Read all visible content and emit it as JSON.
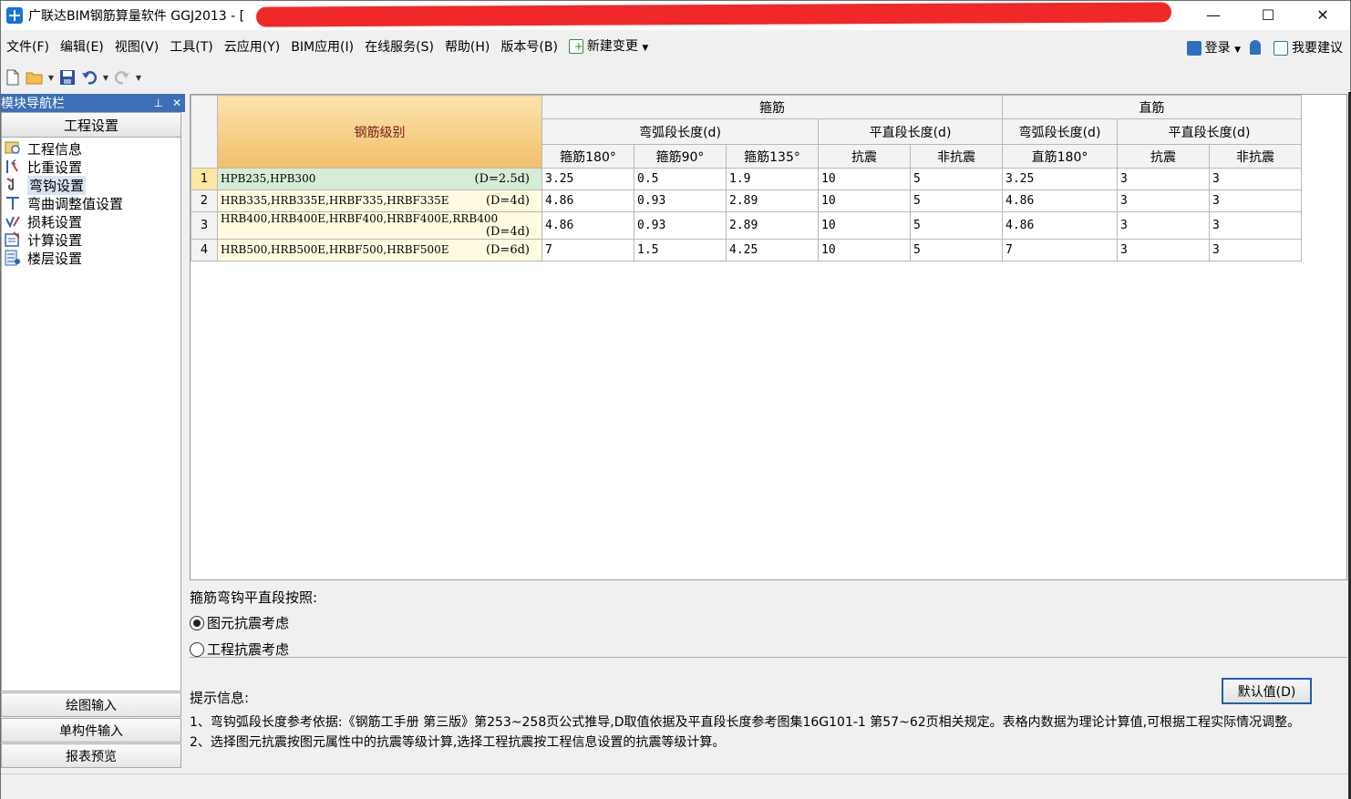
{
  "window": {
    "title": "广联达BIM钢筋算量软件 GGJ2013 - [",
    "min_label": "—",
    "max_label": "☐",
    "close_label": "✕"
  },
  "menu": {
    "items": [
      "文件(F)",
      "编辑(E)",
      "视图(V)",
      "工具(T)",
      "云应用(Y)",
      "BIM应用(I)",
      "在线服务(S)",
      "帮助(H)",
      "版本号(B)",
      "新建变更"
    ],
    "login": "登录",
    "suggest": "我要建议"
  },
  "nav": {
    "panel_title": "模块导航栏",
    "section": "工程设置",
    "items": [
      "工程信息",
      "比重设置",
      "弯钩设置",
      "弯曲调整值设置",
      "损耗设置",
      "计算设置",
      "楼层设置"
    ],
    "selected": "弯钩设置",
    "bottom": [
      "绘图输入",
      "单构件输入",
      "报表预览"
    ]
  },
  "grid": {
    "grade_header": "钢筋级别",
    "group_stirrup": "箍筋",
    "group_straight": "直筋",
    "arc_len": "弯弧段长度(d)",
    "flat_len": "平直段长度(d)",
    "stirrup_arc_cols": [
      "箍筋180°",
      "箍筋90°",
      "箍筋135°"
    ],
    "stirrup_flat_cols": [
      "抗震",
      "非抗震"
    ],
    "straight_arc_cols": [
      "直筋180°"
    ],
    "straight_flat_cols": [
      "抗震",
      "非抗震"
    ],
    "rows": [
      {
        "n": "1",
        "name": "HPB235,HPB300",
        "d": "(D=2.5d)",
        "v": [
          "3.25",
          "0.5",
          "1.9",
          "10",
          "5",
          "3.25",
          "3",
          "3"
        ]
      },
      {
        "n": "2",
        "name": "HRB335,HRB335E,HRBF335,HRBF335E",
        "d": "(D=4d)",
        "v": [
          "4.86",
          "0.93",
          "2.89",
          "10",
          "5",
          "4.86",
          "3",
          "3"
        ]
      },
      {
        "n": "3",
        "name": "HRB400,HRB400E,HRBF400,HRBF400E,RRB400",
        "d": "(D=4d)",
        "v": [
          "4.86",
          "0.93",
          "2.89",
          "10",
          "5",
          "4.86",
          "3",
          "3"
        ]
      },
      {
        "n": "4",
        "name": "HRB500,HRB500E,HRBF500,HRBF500E",
        "d": "(D=6d)",
        "v": [
          "7",
          "1.5",
          "4.25",
          "10",
          "5",
          "7",
          "3",
          "3"
        ]
      }
    ]
  },
  "options": {
    "title": "箍筋弯钩平直段按照:",
    "radio1": "图元抗震考虑",
    "radio2": "工程抗震考虑",
    "selected": "图元抗震考虑"
  },
  "hint": {
    "title": "提示信息:",
    "default_button": "默认值(D)",
    "line1": "1、弯钩弧段长度参考依据:《钢筋工手册 第三版》第253~258页公式推导,D取值依据及平直段长度参考图集16G101-1 第57~62页相关规定。表格内数据为理论计算值,可根据工程实际情况调整。",
    "line2": "2、选择图元抗震按图元属性中的抗震等级计算,选择工程抗震按工程信息设置的抗震等级计算。"
  },
  "colors": {
    "accent": "#3c6fb7",
    "grade_header_bg": "#f2bf69",
    "selected_row": "#d7ecd6",
    "name_bg": "#fffbe1",
    "redaction": "#f02828"
  },
  "icons": [
    "app-icon",
    "new-file-icon",
    "open-folder-icon",
    "save-icon",
    "undo-icon",
    "redo-icon",
    "new-change-icon",
    "user-icon",
    "bell-icon",
    "suggest-icon",
    "pin-icon",
    "close-icon"
  ]
}
